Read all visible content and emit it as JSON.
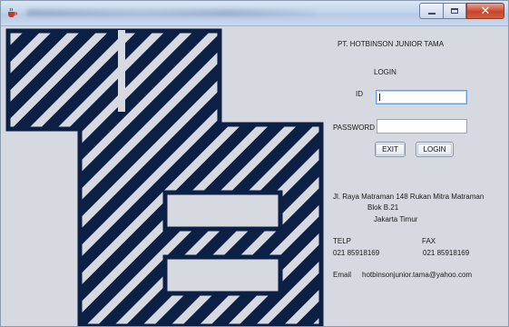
{
  "window": {
    "title_obscured": true,
    "app_icon": "java-cup-icon",
    "controls": {
      "minimize": "minimize-icon",
      "maximize": "maximize-icon",
      "close": "close-icon"
    }
  },
  "company": "PT. HOTBINSON JUNIOR TAMA",
  "login_form": {
    "heading": "LOGIN",
    "id_label": "ID",
    "id_value": "",
    "password_label": "PASSWORD",
    "password_value": "",
    "exit_button": "EXIT",
    "login_button": "LOGIN"
  },
  "address": {
    "line1": "Jl. Raya Matraman 148 Rukan Mitra Matraman",
    "line2": "Blok B.21",
    "line3": "Jakarta Timur"
  },
  "contact": {
    "telp_label": "TELP",
    "telp_value": "021 85918169",
    "fax_label": "FAX",
    "fax_value": "021 85918169",
    "email_label": "Email",
    "email_value": "hotbinsonjunior.tama@yahoo.com"
  },
  "colors": {
    "logo_navy": "#0c1f45",
    "panel_bg": "#d6d9df"
  }
}
